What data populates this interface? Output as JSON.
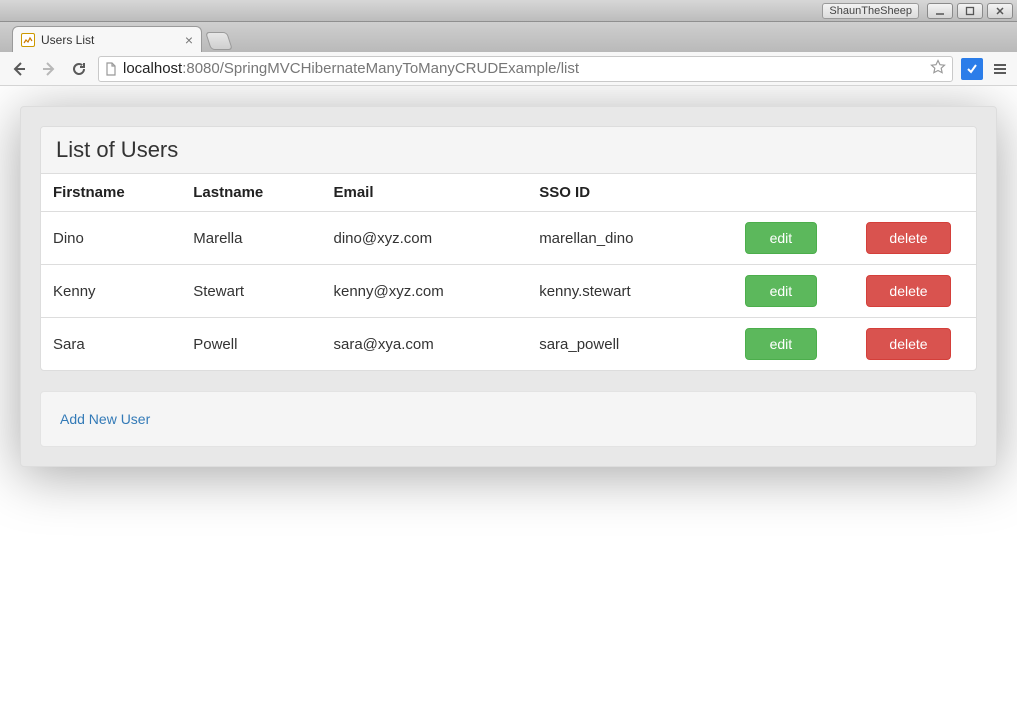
{
  "os": {
    "user_badge": "ShaunTheSheep"
  },
  "browser": {
    "tab_title": "Users List",
    "url_host_lead": "localhost",
    "url_rest": ":8080/SpringMVCHibernateManyToManyCRUDExample/list"
  },
  "page": {
    "heading": "List of Users",
    "columns": {
      "firstname": "Firstname",
      "lastname": "Lastname",
      "email": "Email",
      "sso": "SSO ID",
      "edit": "",
      "delete": ""
    },
    "buttons": {
      "edit": "edit",
      "delete": "delete"
    },
    "users": [
      {
        "firstname": "Dino",
        "lastname": "Marella",
        "email": "dino@xyz.com",
        "sso": "marellan_dino"
      },
      {
        "firstname": "Kenny",
        "lastname": "Stewart",
        "email": "kenny@xyz.com",
        "sso": "kenny.stewart"
      },
      {
        "firstname": "Sara",
        "lastname": "Powell",
        "email": "sara@xya.com",
        "sso": "sara_powell"
      }
    ],
    "add_link": "Add New User"
  }
}
